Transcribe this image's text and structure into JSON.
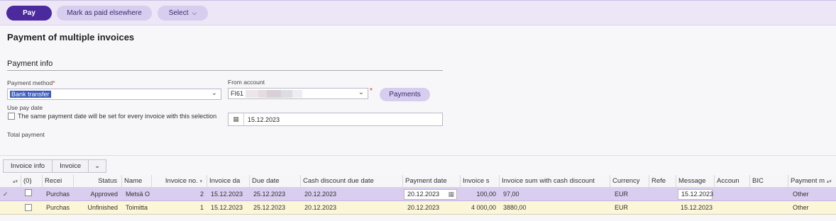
{
  "toolbar": {
    "pay": "Pay",
    "mark_paid": "Mark as paid elsewhere",
    "select": "Select"
  },
  "page_title": "Payment of multiple invoices",
  "payment_info": {
    "section_title": "Payment info",
    "payment_method_label": "Payment method",
    "payment_method_value": "Bank transfer",
    "use_pay_date_label": "Use pay date",
    "same_date_text": "The same payment date will be set for every invoice with this selection",
    "total_payment_label": "Total payment",
    "from_account_label": "From account",
    "from_account_value": "FI61",
    "payments_button": "Payments",
    "pay_date_value": "15.12.2023",
    "required_mark": "*"
  },
  "tabs": [
    "Invoice info",
    "Invoice"
  ],
  "columns": {
    "count": "(0)",
    "recei": "Recei",
    "status": "Status",
    "name": "Name",
    "invoice_no": "Invoice no.",
    "invoice_date": "Invoice da",
    "due_date": "Due date",
    "cash_discount_due": "Cash discount due date",
    "payment_date": "Payment date",
    "invoice_sum": "Invoice s",
    "invoice_sum_cd": "Invoice sum with cash discount",
    "currency": "Currency",
    "refe": "Refe",
    "message": "Message",
    "accoun": "Accoun",
    "bic": "BIC",
    "payment_m": "Payment m"
  },
  "rows": [
    {
      "recei": "Purchas",
      "status": "Approved",
      "name": "Metsä O",
      "invoice_no": "2",
      "invoice_date": "15.12.2023",
      "due_date": "25.12.2023",
      "cash_discount_due": "20.12.2023",
      "payment_date": "20.12.2023",
      "invoice_sum": "100,00",
      "invoice_sum_cd": "97,00",
      "currency": "EUR",
      "message": "15.12.2023",
      "payment_m": "Other"
    },
    {
      "recei": "Purchas",
      "status": "Unfinished",
      "name": "Toimitta",
      "invoice_no": "1",
      "invoice_date": "15.12.2023",
      "due_date": "25.12.2023",
      "cash_discount_due": "20.12.2023",
      "payment_date": "20.12.2023",
      "invoice_sum": "4 000,00",
      "invoice_sum_cd": "3880,00",
      "currency": "EUR",
      "message": "15.12.2023",
      "payment_m": "Other"
    }
  ],
  "colors": {
    "primary": "#4b2a9e",
    "secondary": "#d7cdee",
    "selected_row": "#d9cdf0",
    "unfinished_row": "#fbf6d8"
  }
}
